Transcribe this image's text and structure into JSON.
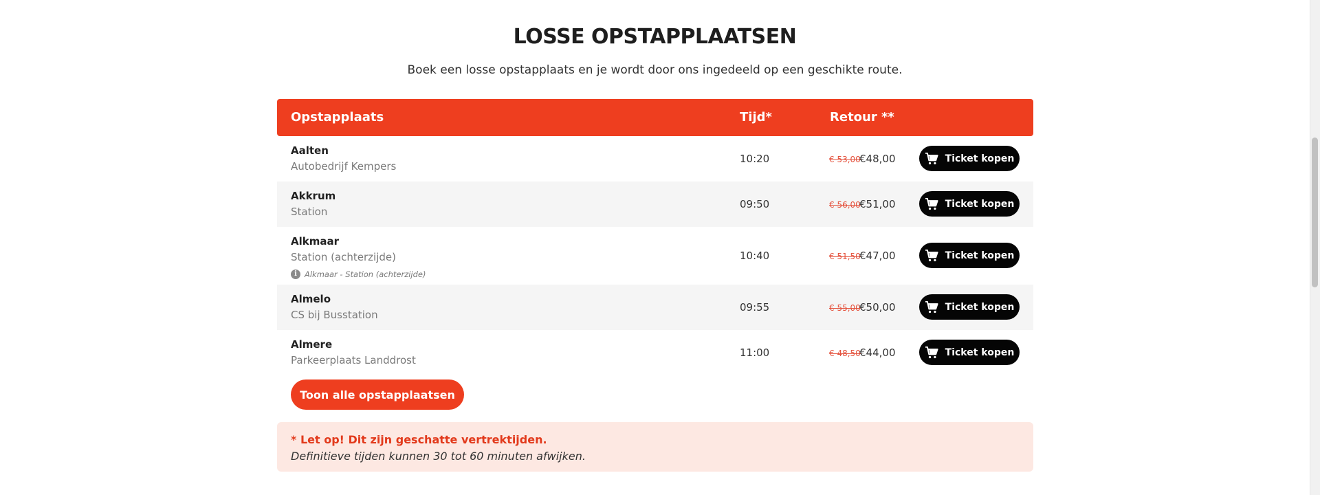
{
  "header": {
    "title": "LOSSE OPSTAPPLAATSEN",
    "subtitle": "Boek een losse opstapplaats en je wordt door ons ingedeeld op een geschikte route."
  },
  "table": {
    "columns": {
      "place": "Opstapplaats",
      "time": "Tijd*",
      "retour": "Retour **"
    },
    "rows": [
      {
        "city": "Aalten",
        "location": "Autobedrijf Kempers",
        "note": "",
        "time": "10:20",
        "old_price": "€ 53,00",
        "price": "€48,00",
        "button": "Ticket kopen"
      },
      {
        "city": "Akkrum",
        "location": "Station",
        "note": "",
        "time": "09:50",
        "old_price": "€ 56,00",
        "price": "€51,00",
        "button": "Ticket kopen"
      },
      {
        "city": "Alkmaar",
        "location": "Station (achterzijde)",
        "note": "Alkmaar - Station (achterzijde)",
        "time": "10:40",
        "old_price": "€ 51,50",
        "price": "€47,00",
        "button": "Ticket kopen"
      },
      {
        "city": "Almelo",
        "location": "CS bij Busstation",
        "note": "",
        "time": "09:55",
        "old_price": "€ 55,00",
        "price": "€50,00",
        "button": "Ticket kopen"
      },
      {
        "city": "Almere",
        "location": "Parkeerplaats Landdrost",
        "note": "",
        "time": "11:00",
        "old_price": "€ 48,50",
        "price": "€44,00",
        "button": "Ticket kopen"
      }
    ]
  },
  "show_all_label": "Toon alle opstapplaatsen",
  "notice": {
    "line1": "* Let op! Dit zijn geschatte vertrektijden.",
    "line2": "Definitieve tijden kunnen 30 tot 60 minuten afwijken."
  },
  "colors": {
    "accent": "#ee3e1f",
    "notice_bg": "#fde8e2",
    "button_dark": "#050505"
  }
}
